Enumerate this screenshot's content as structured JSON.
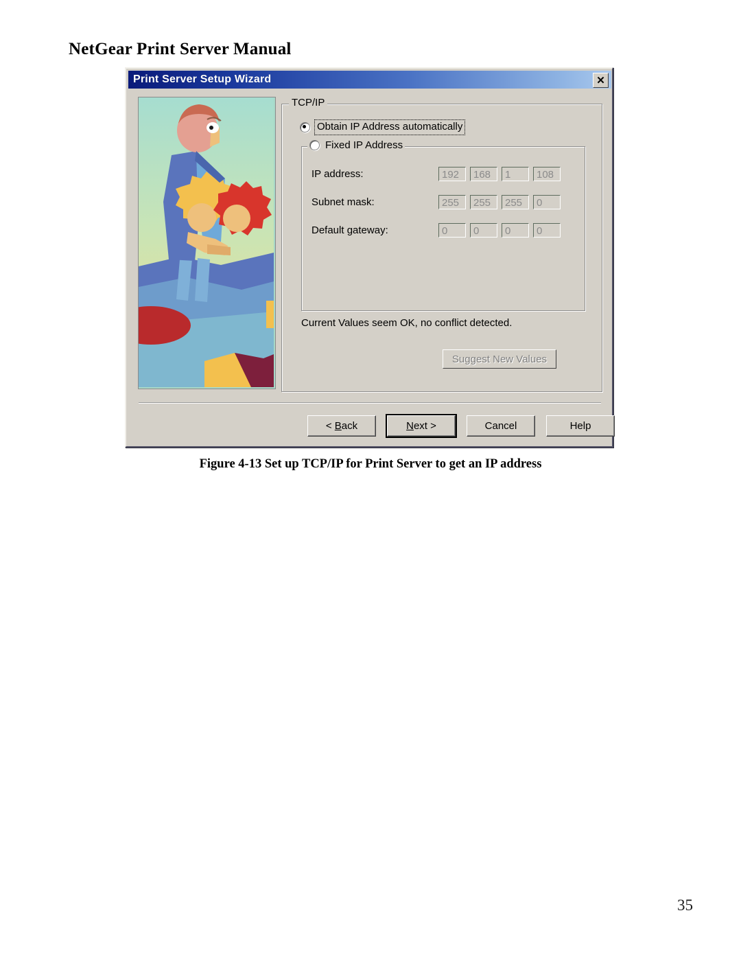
{
  "document": {
    "header_title": "NetGear Print Server Manual",
    "figure_caption": "Figure 4-13 Set up TCP/IP for Print Server to get an IP address",
    "page_number": "35"
  },
  "dialog": {
    "title": "Print Server Setup Wizard",
    "close_icon": "close-icon",
    "close_glyph": "✕",
    "illustration_alt": "wizard-illustration",
    "titlebar_color_start": "#0a1a7a",
    "titlebar_color_end": "#a9c8ee",
    "face_color": "#d4d0c8",
    "tcpip": {
      "legend": "TCP/IP",
      "radio_auto": {
        "label": "Obtain IP Address automatically",
        "checked": true,
        "focused": true
      },
      "radio_fixed": {
        "label": "Fixed IP Address",
        "checked": false
      },
      "fields": [
        {
          "label": "IP address:",
          "octets": [
            "192",
            "168",
            "1",
            "108"
          ],
          "disabled": true
        },
        {
          "label": "Subnet mask:",
          "octets": [
            "255",
            "255",
            "255",
            "0"
          ],
          "disabled": true
        },
        {
          "label": "Default gateway:",
          "octets": [
            "0",
            "0",
            "0",
            "0"
          ],
          "disabled": true
        }
      ],
      "status_text": "Current Values seem OK, no conflict detected.",
      "suggest_button": {
        "label": "Suggest New Values",
        "disabled": true
      }
    },
    "footer_buttons": [
      {
        "label": "< Back",
        "mnemonic": "B",
        "default": false
      },
      {
        "label": "Next >",
        "mnemonic": "N",
        "default": true
      },
      {
        "label": "Cancel",
        "mnemonic": "",
        "default": false
      },
      {
        "label": "Help",
        "mnemonic": "",
        "default": false
      }
    ]
  }
}
